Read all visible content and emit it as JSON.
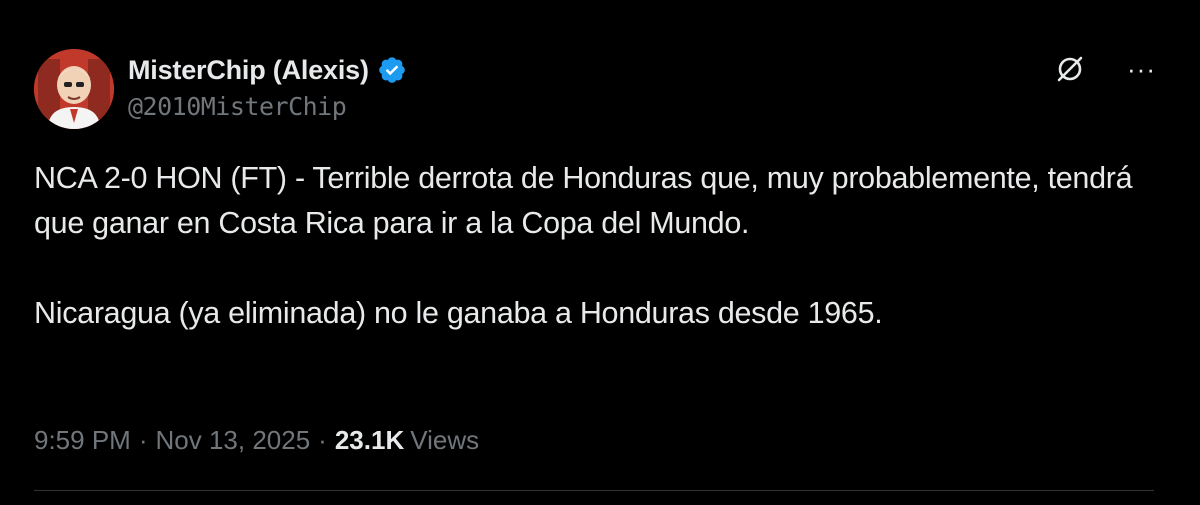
{
  "author": {
    "display_name": "MisterChip (Alexis)",
    "handle": "@2010MisterChip",
    "verified": true,
    "avatar_icon": "avatar-caricature"
  },
  "actions": {
    "grok_icon": "grok-icon",
    "more_label": "···"
  },
  "tweet": {
    "paragraph_1": "NCA 2-0 HON (FT) - Terrible derrota de Honduras que, muy probablemente, tendrá que ganar en Costa Rica para ir a la Copa del Mundo.",
    "paragraph_2": "Nicaragua (ya eliminada) no le ganaba a Honduras desde 1965."
  },
  "meta": {
    "time": "9:59 PM",
    "separator": "·",
    "date": "Nov 13, 2025",
    "views_count": "23.1K",
    "views_label": "Views"
  },
  "colors": {
    "background": "#000000",
    "text_primary": "#e7e9ea",
    "text_secondary": "#71767b",
    "verified_blue": "#1d9bf0"
  }
}
